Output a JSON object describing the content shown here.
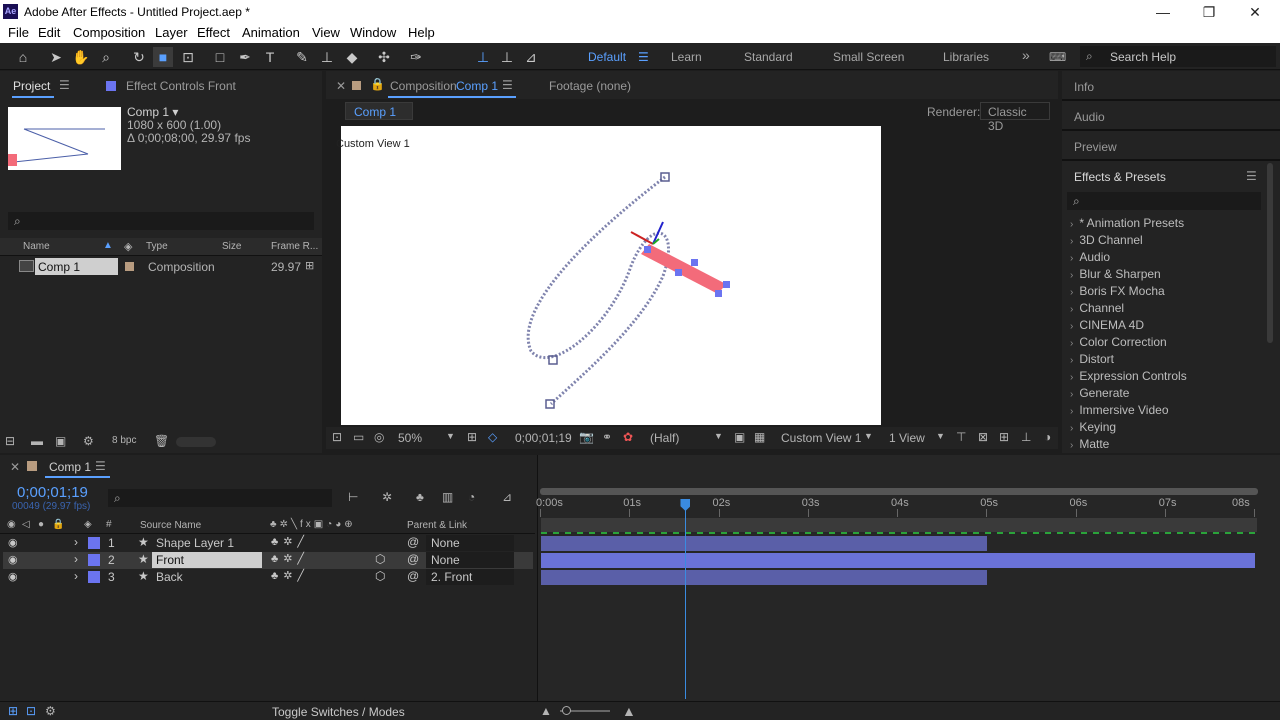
{
  "window": {
    "title": "Adobe After Effects - Untitled Project.aep *",
    "logo": "Ae",
    "min": "—",
    "max": "❐",
    "close": "✕"
  },
  "menu": [
    "File",
    "Edit",
    "Composition",
    "Layer",
    "Effect",
    "Animation",
    "View",
    "Window",
    "Help"
  ],
  "workspaces": {
    "default": "Default",
    "learn": "Learn",
    "standard": "Standard",
    "small_screen": "Small Screen",
    "libraries": "Libraries",
    "more": "»",
    "search_placeholder": "Search Help"
  },
  "project": {
    "tab_project": "Project",
    "tab_effect_controls": "Effect Controls Front",
    "comp_name": "Comp 1 ▾",
    "comp_size": "1080 x 600 (1.00)",
    "comp_duration": "Δ 0;00;08;00, 29.97 fps",
    "columns": {
      "name": "Name",
      "type": "Type",
      "size": "Size",
      "frame_rate": "Frame R..."
    },
    "items": [
      {
        "name": "Comp 1",
        "type": "Composition",
        "frame_rate": "29.97"
      }
    ],
    "bpc": "8 bpc"
  },
  "composition": {
    "tab_label": "Composition",
    "tab_comp": "Comp 1",
    "footage_tab": "Footage (none)",
    "breadcrumb": "Comp 1",
    "renderer_label": "Renderer:",
    "renderer_value": "Classic 3D",
    "view_label": "Custom View 1",
    "zoom": "50%",
    "timecode": "0;00;01;19",
    "resolution": "(Half)",
    "view_select": "Custom View 1",
    "layout_select": "1 View"
  },
  "right_panels": {
    "info": "Info",
    "audio": "Audio",
    "preview": "Preview",
    "effects_presets": "Effects & Presets"
  },
  "effects": [
    "* Animation Presets",
    "3D Channel",
    "Audio",
    "Blur & Sharpen",
    "Boris FX Mocha",
    "Channel",
    "CINEMA 4D",
    "Color Correction",
    "Distort",
    "Expression Controls",
    "Generate",
    "Immersive Video",
    "Keying",
    "Matte"
  ],
  "timeline": {
    "tab": "Comp 1",
    "timecode": "0;00;01;19",
    "frame_info": "00049 (29.97 fps)",
    "columns": {
      "source_name": "Source Name",
      "parent_link": "Parent & Link"
    },
    "layers": [
      {
        "num": "1",
        "name": "Shape Layer 1",
        "parent": "None",
        "color": "#6b74f0"
      },
      {
        "num": "2",
        "name": "Front",
        "parent": "None",
        "color": "#6b74f0"
      },
      {
        "num": "3",
        "name": "Back",
        "parent": "2. Front",
        "color": "#6b74f0"
      }
    ],
    "ruler": [
      "0:00s",
      "01s",
      "02s",
      "03s",
      "04s",
      "05s",
      "06s",
      "07s",
      "08s"
    ],
    "playhead_seconds": 1.63,
    "bar_end_seconds": [
      5.0,
      8.0,
      5.0
    ],
    "toggle_label": "Toggle Switches / Modes"
  }
}
